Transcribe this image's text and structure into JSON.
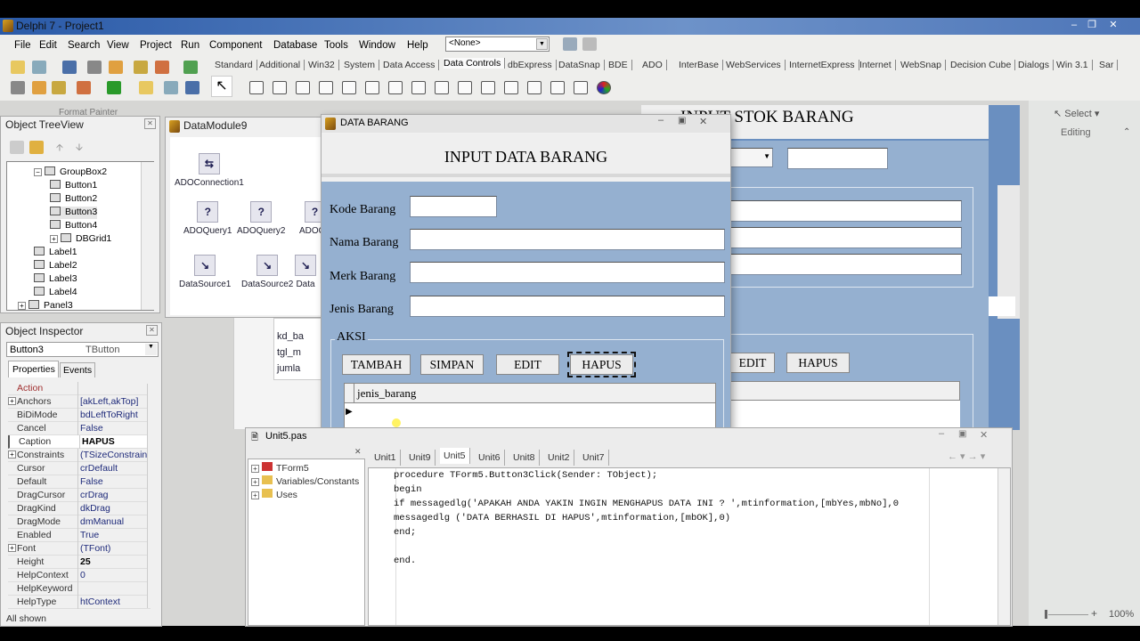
{
  "app": {
    "title": "Delphi 7 - Project1",
    "window_controls": [
      "minimize",
      "restore",
      "close"
    ]
  },
  "menu": [
    "File",
    "Edit",
    "Search",
    "View",
    "Project",
    "Run",
    "Component",
    "Database",
    "Tools",
    "Window",
    "Help"
  ],
  "component_combo": "<None>",
  "palette_tabs": [
    "Standard",
    "Additional",
    "Win32",
    "System",
    "Data Access",
    "Data Controls",
    "dbExpress",
    "DataSnap",
    "BDE",
    "ADO",
    "InterBase",
    "WebServices",
    "InternetExpress",
    "Internet",
    "WebSnap",
    "Decision Cube",
    "Dialogs",
    "Win 3.1",
    "Sar"
  ],
  "palette_active": "Data Controls",
  "background_word": {
    "format_painter": "Format Painter",
    "select": "Select",
    "editing": "Editing",
    "zoom": "100%"
  },
  "tree_view": {
    "title": "Object TreeView",
    "items": [
      {
        "label": "GroupBox2",
        "level": 2,
        "expandable": true
      },
      {
        "label": "Button1",
        "level": 3
      },
      {
        "label": "Button2",
        "level": 3
      },
      {
        "label": "Button3",
        "level": 3,
        "selected": true
      },
      {
        "label": "Button4",
        "level": 3
      },
      {
        "label": "DBGrid1",
        "level": 3,
        "expandable": true
      },
      {
        "label": "Label1",
        "level": 2
      },
      {
        "label": "Label2",
        "level": 2
      },
      {
        "label": "Label3",
        "level": 2
      },
      {
        "label": "Label4",
        "level": 2
      },
      {
        "label": "Panel3",
        "level": 1,
        "expandable": true
      }
    ]
  },
  "data_module": {
    "title": "DataModule9",
    "components": [
      "ADOConnection1",
      "ADOQuery1",
      "ADOQuery2",
      "ADOQu",
      "DataSource1",
      "DataSource2",
      "Data"
    ]
  },
  "field_list": [
    "kd_ba",
    "tgl_m",
    "jumla"
  ],
  "object_inspector": {
    "title": "Object Inspector",
    "selected": "Button3",
    "selected_type": "TButton",
    "tabs": [
      "Properties",
      "Events"
    ],
    "rows": [
      [
        "Action",
        ""
      ],
      [
        "Anchors",
        "[akLeft,akTop]"
      ],
      [
        "BiDiMode",
        "bdLeftToRight"
      ],
      [
        "Cancel",
        "False"
      ],
      [
        "Caption",
        "HAPUS"
      ],
      [
        "Constraints",
        "(TSizeConstraint"
      ],
      [
        "Cursor",
        "crDefault"
      ],
      [
        "Default",
        "False"
      ],
      [
        "DragCursor",
        "crDrag"
      ],
      [
        "DragKind",
        "dkDrag"
      ],
      [
        "DragMode",
        "dmManual"
      ],
      [
        "Enabled",
        "True"
      ],
      [
        "Font",
        "(TFont)"
      ],
      [
        "Height",
        "25"
      ],
      [
        "HelpContext",
        "0"
      ],
      [
        "HelpKeyword",
        ""
      ],
      [
        "HelpType",
        "htContext"
      ]
    ],
    "status": "All shown"
  },
  "back_form": {
    "title": "INPUT STOK BARANG",
    "buttons": [
      "EDIT",
      "HAPUS"
    ]
  },
  "form": {
    "title": "DATA BARANG",
    "heading": "INPUT DATA BARANG",
    "labels": [
      "Kode Barang",
      "Nama Barang",
      "Merk Barang",
      "Jenis Barang"
    ],
    "group": "AKSI",
    "buttons": [
      "TAMBAH",
      "SIMPAN",
      "EDIT",
      "HAPUS"
    ],
    "grid_column": "jenis_barang"
  },
  "editor": {
    "title": "Unit5.pas",
    "explorer": [
      "TForm5",
      "Variables/Constants",
      "Uses"
    ],
    "tabs": [
      "Unit1",
      "Unit9",
      "Unit5",
      "Unit6",
      "Unit8",
      "Unit2",
      "Unit7"
    ],
    "active_tab": "Unit5",
    "code": [
      "procedure TForm5.Button3Click(Sender: TObject);",
      "begin",
      "if messagedlg('APAKAH ANDA YAKIN INGIN MENGHAPUS DATA INI ? ',mtinformation,[mbYes,mbNo],0",
      "messagedlg ('DATA BERHASIL DI HAPUS',mtinformation,[mbOK],0)",
      "end;",
      "",
      "end."
    ]
  }
}
